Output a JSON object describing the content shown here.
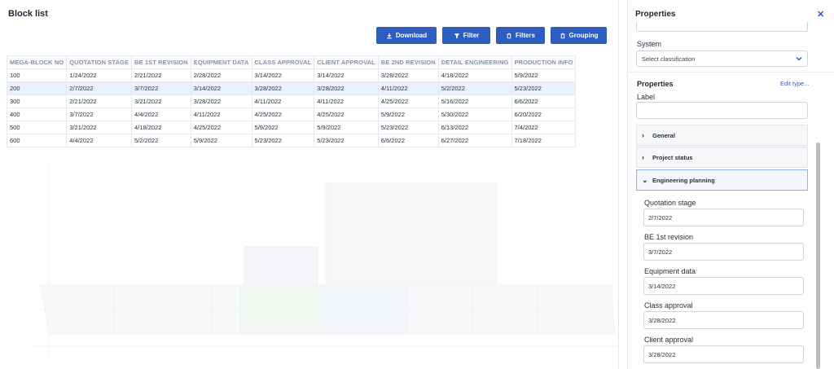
{
  "block_list": {
    "title": "Block list",
    "toolbar": {
      "download": "Download",
      "filter": "Filter",
      "filters": "Filters",
      "grouping": "Grouping"
    },
    "columns": [
      "MEGA-BLOCK NO",
      "QUOTATION STAGE",
      "BE 1ST REVISION",
      "EQUIPMENT DATA",
      "CLASS APPROVAL",
      "CLIENT APPROVAL",
      "BE 2ND REVISION",
      "DETAIL ENGINEERING",
      "PRODUCTION INFO"
    ],
    "rows": [
      [
        "100",
        "1/24/2022",
        "2/21/2022",
        "2/28/2022",
        "3/14/2022",
        "3/14/2022",
        "3/28/2022",
        "4/18/2022",
        "5/9/2022"
      ],
      [
        "200",
        "2/7/2022",
        "3/7/2022",
        "3/14/2022",
        "3/28/2022",
        "3/28/2022",
        "4/11/2022",
        "5/2/2022",
        "5/23/2022"
      ],
      [
        "300",
        "2/21/2022",
        "3/21/2022",
        "3/28/2022",
        "4/11/2022",
        "4/11/2022",
        "4/25/2022",
        "5/16/2022",
        "6/6/2022"
      ],
      [
        "400",
        "3/7/2022",
        "4/4/2022",
        "4/11/2022",
        "4/25/2022",
        "4/25/2022",
        "5/9/2022",
        "5/30/2022",
        "6/20/2022"
      ],
      [
        "500",
        "3/21/2022",
        "4/18/2022",
        "4/25/2022",
        "5/9/2022",
        "5/9/2022",
        "5/23/2022",
        "6/13/2022",
        "7/4/2022"
      ],
      [
        "600",
        "4/4/2022",
        "5/2/2022",
        "5/9/2022",
        "5/23/2022",
        "5/23/2022",
        "6/6/2022",
        "6/27/2022",
        "7/18/2022"
      ]
    ],
    "selected_row": "200"
  },
  "properties": {
    "title": "Properties",
    "system_label": "System",
    "system_placeholder": "Select classification",
    "section_title": "Properties",
    "edit_type": "Edit type...",
    "label_label": "Label",
    "label_value": "",
    "accordions": [
      {
        "label": "General",
        "open": false
      },
      {
        "label": "Project status",
        "open": false
      },
      {
        "label": "Engineering planning",
        "open": true
      }
    ],
    "fields": [
      {
        "label": "Quotation stage",
        "value": "2/7/2022"
      },
      {
        "label": "BE 1st revision",
        "value": "3/7/2022"
      },
      {
        "label": "Equipment data",
        "value": "3/14/2022"
      },
      {
        "label": "Class approval",
        "value": "3/28/2022"
      },
      {
        "label": "Client approval",
        "value": "3/28/2022"
      }
    ]
  },
  "colors": {
    "accent": "#2e5dc2",
    "selected_row": "#e9f1fc"
  }
}
